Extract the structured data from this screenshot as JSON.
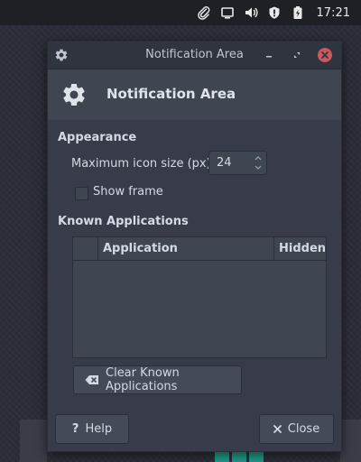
{
  "panel": {
    "clock": "17:21",
    "tray_icons": [
      "paperclip-icon",
      "display-icon",
      "volume-icon",
      "security-icon",
      "battery-icon"
    ]
  },
  "window": {
    "title": "Notification Area",
    "header_title": "Notification Area",
    "appearance": {
      "section_label": "Appearance",
      "icon_size_label": "Maximum icon size (px):",
      "icon_size_value": "24",
      "show_frame_label": "Show frame",
      "show_frame_checked": false
    },
    "known_apps": {
      "section_label": "Known Applications",
      "columns": [
        "Application",
        "Hidden"
      ],
      "rows": []
    },
    "buttons": {
      "clear": "Clear Known Applications",
      "help": "Help",
      "close": "Close"
    }
  },
  "colors": {
    "window_bg": "#383c4a",
    "titlebar_bg": "#2f343f",
    "close_button": "#cc575d",
    "text": "#d3dae3",
    "accent": "#1e9a85"
  }
}
